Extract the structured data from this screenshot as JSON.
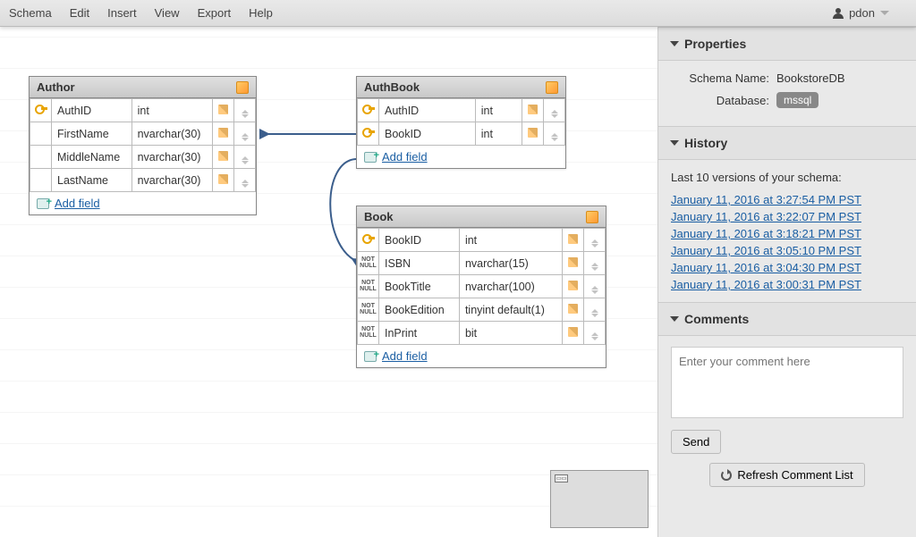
{
  "menubar": {
    "items": [
      "Schema",
      "Edit",
      "Insert",
      "View",
      "Export",
      "Help"
    ],
    "user": "pdon"
  },
  "tables": {
    "author": {
      "title": "Author",
      "add_field": "Add field",
      "rows": [
        {
          "key": "pk",
          "name": "AuthID",
          "type": "int"
        },
        {
          "key": "",
          "name": "FirstName",
          "type": "nvarchar(30)"
        },
        {
          "key": "",
          "name": "MiddleName",
          "type": "nvarchar(30)"
        },
        {
          "key": "",
          "name": "LastName",
          "type": "nvarchar(30)"
        }
      ]
    },
    "authbook": {
      "title": "AuthBook",
      "add_field": "Add field",
      "rows": [
        {
          "key": "pk",
          "name": "AuthID",
          "type": "int"
        },
        {
          "key": "pk",
          "name": "BookID",
          "type": "int"
        }
      ]
    },
    "book": {
      "title": "Book",
      "add_field": "Add field",
      "rows": [
        {
          "key": "pk",
          "name": "BookID",
          "type": "int"
        },
        {
          "key": "nn",
          "name": "ISBN",
          "type": "nvarchar(15)"
        },
        {
          "key": "nn",
          "name": "BookTitle",
          "type": "nvarchar(100)"
        },
        {
          "key": "nn",
          "name": "BookEdition",
          "type": "tinyint default(1)"
        },
        {
          "key": "nn",
          "name": "InPrint",
          "type": "bit"
        }
      ]
    }
  },
  "properties": {
    "header": "Properties",
    "schema_name_label": "Schema Name:",
    "schema_name_value": "BookstoreDB",
    "database_label": "Database:",
    "database_value": "mssql"
  },
  "history": {
    "header": "History",
    "intro": "Last 10 versions of your schema:",
    "items": [
      "January 11, 2016 at 3:27:54 PM PST",
      "January 11, 2016 at 3:22:07 PM PST",
      "January 11, 2016 at 3:18:21 PM PST",
      "January 11, 2016 at 3:05:10 PM PST",
      "January 11, 2016 at 3:04:30 PM PST",
      "January 11, 2016 at 3:00:31 PM PST"
    ]
  },
  "comments": {
    "header": "Comments",
    "placeholder": "Enter your comment here",
    "send": "Send",
    "refresh": "Refresh Comment List"
  }
}
